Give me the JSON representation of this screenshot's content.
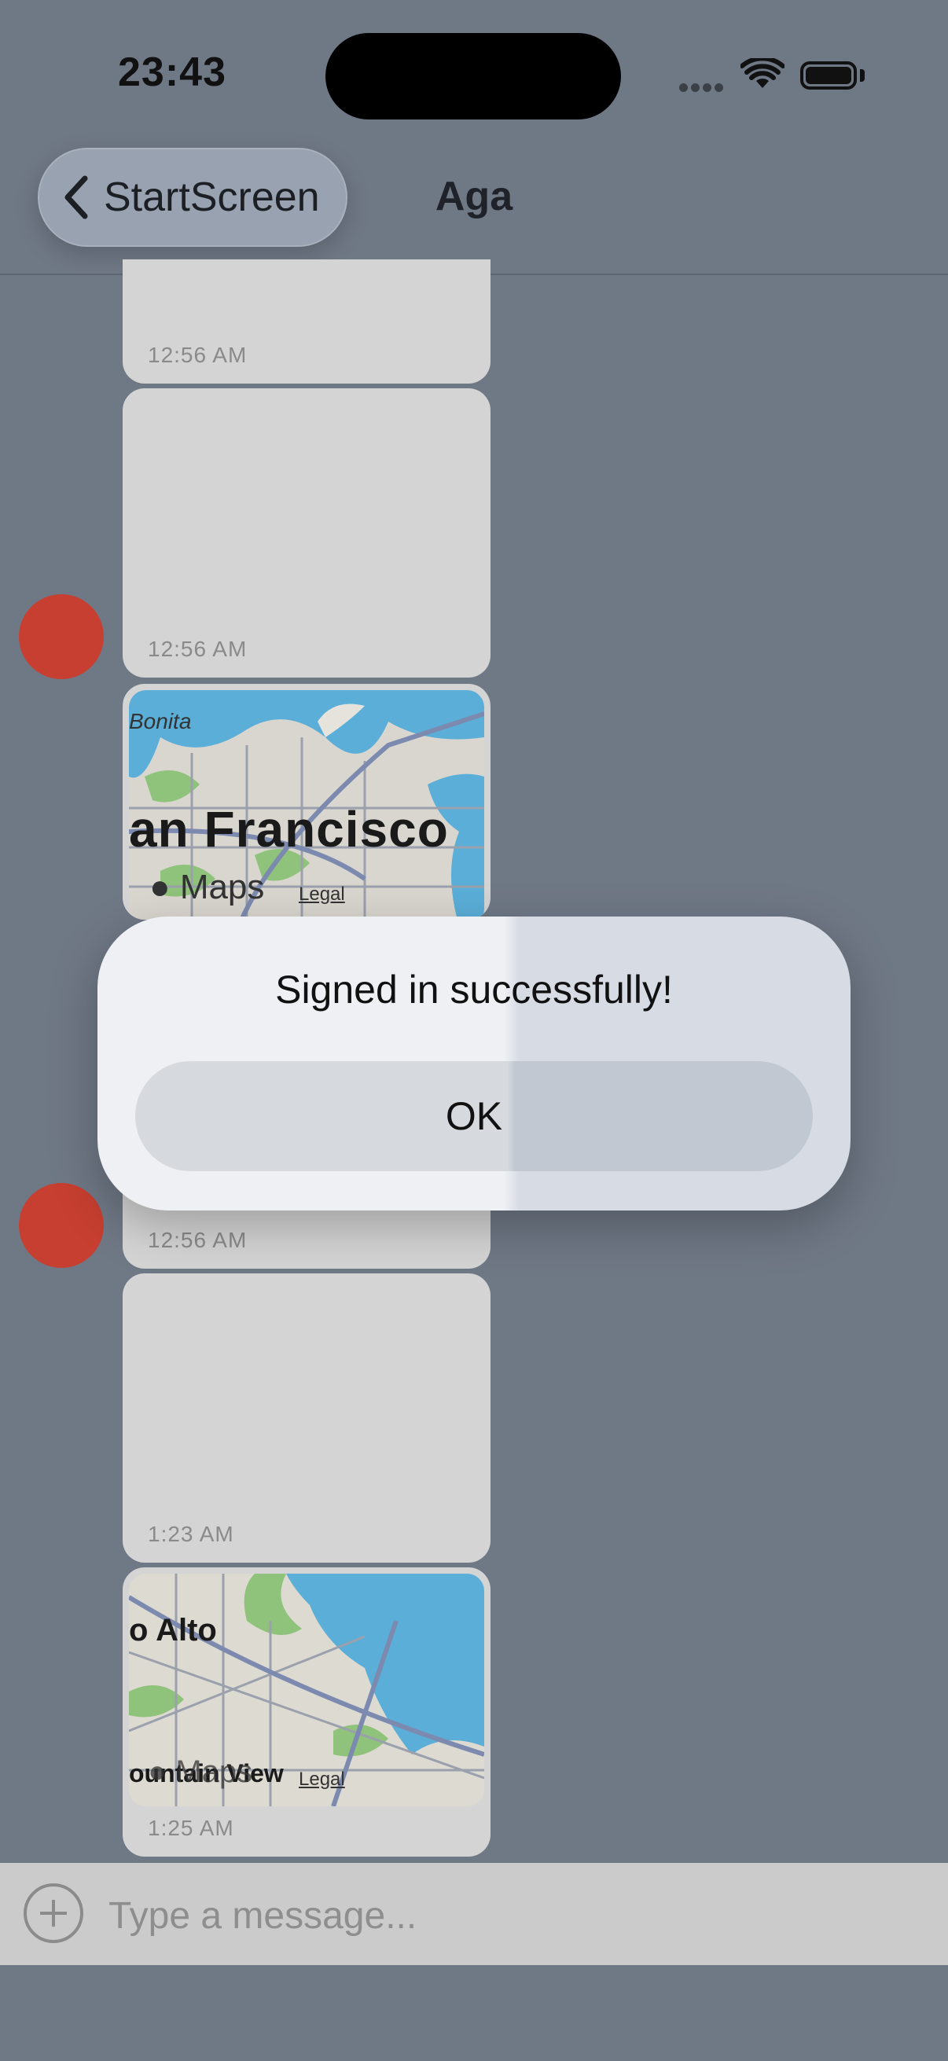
{
  "status_bar": {
    "time": "23:43"
  },
  "nav": {
    "back_label": "StartScreen",
    "title": "Aga"
  },
  "messages": [
    {
      "time": "12:56 AM"
    },
    {
      "time": "12:56 AM"
    },
    {
      "map": {
        "label_small": "Bonita",
        "label_city": "an Francisco",
        "brand": "Maps",
        "legal": "Legal"
      }
    },
    {
      "time": "12:56 AM"
    },
    {
      "time": "1:23 AM"
    },
    {
      "time": "1:25 AM",
      "map": {
        "label_city": "o Alto",
        "label_small": "ountain View",
        "brand": "Maps",
        "legal": "Legal"
      }
    }
  ],
  "alert": {
    "message": "Signed in successfully!",
    "ok_label": "OK"
  },
  "composer": {
    "placeholder": "Type a message..."
  },
  "colors": {
    "background": "#6f7885",
    "bubble": "#d4d4d4",
    "avatar": "#c73f30"
  }
}
